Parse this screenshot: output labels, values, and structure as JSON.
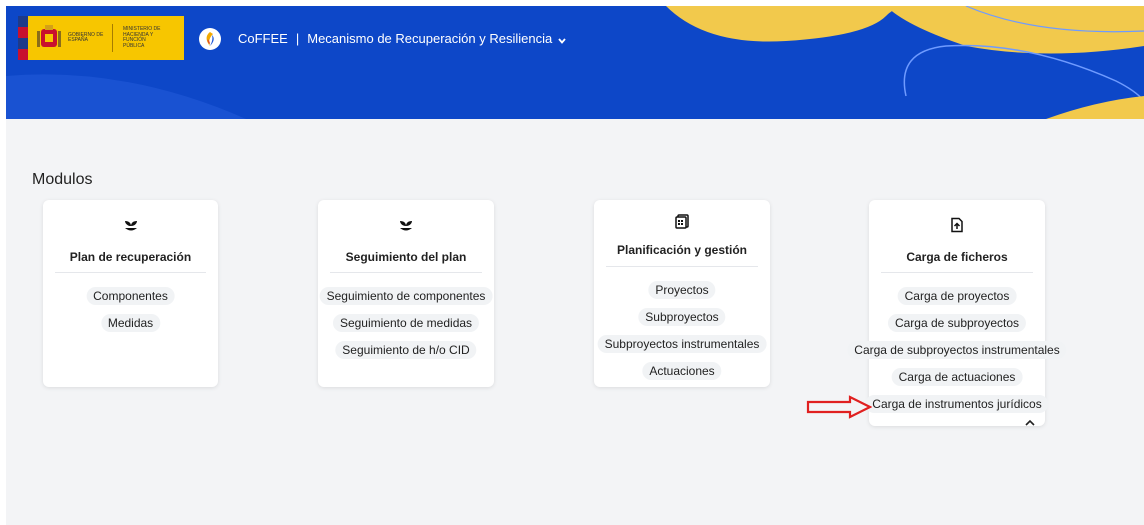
{
  "header": {
    "gov_logo_text": {
      "gobierno": "GOBIERNO DE ESPAÑA",
      "ministerio": "MINISTERIO DE HACIENDA Y FUNCIÓN PÚBLICA"
    },
    "app_name": "CoFFEE",
    "separator": "|",
    "program": "Mecanismo de Recuperación y Resiliencia",
    "dropdown_icon": "chevron-down-icon"
  },
  "section_title": "Modulos",
  "modules": [
    {
      "icon": "sprout-icon",
      "title": "Plan de recuperación",
      "links": [
        "Componentes",
        "Medidas"
      ]
    },
    {
      "icon": "sprout-icon",
      "title": "Seguimiento del plan",
      "links": [
        "Seguimiento de componentes",
        "Seguimiento de medidas",
        "Seguimiento de h/o CID"
      ]
    },
    {
      "icon": "calculator-icon",
      "title": "Planificación y gestión",
      "links": [
        "Proyectos",
        "Subproyectos",
        "Subproyectos instrumentales",
        "Actuaciones"
      ]
    },
    {
      "icon": "file-upload-icon",
      "title": "Carga de ficheros",
      "links": [
        "Carga de proyectos",
        "Carga de subproyectos",
        "Carga de subproyectos instrumentales",
        "Carga de actuaciones",
        "Carga de instrumentos jurídicos"
      ]
    }
  ],
  "colors": {
    "header_blue": "#0d47c8",
    "accent_yellow": "#f2c94c",
    "annotation_red": "#e02020"
  }
}
